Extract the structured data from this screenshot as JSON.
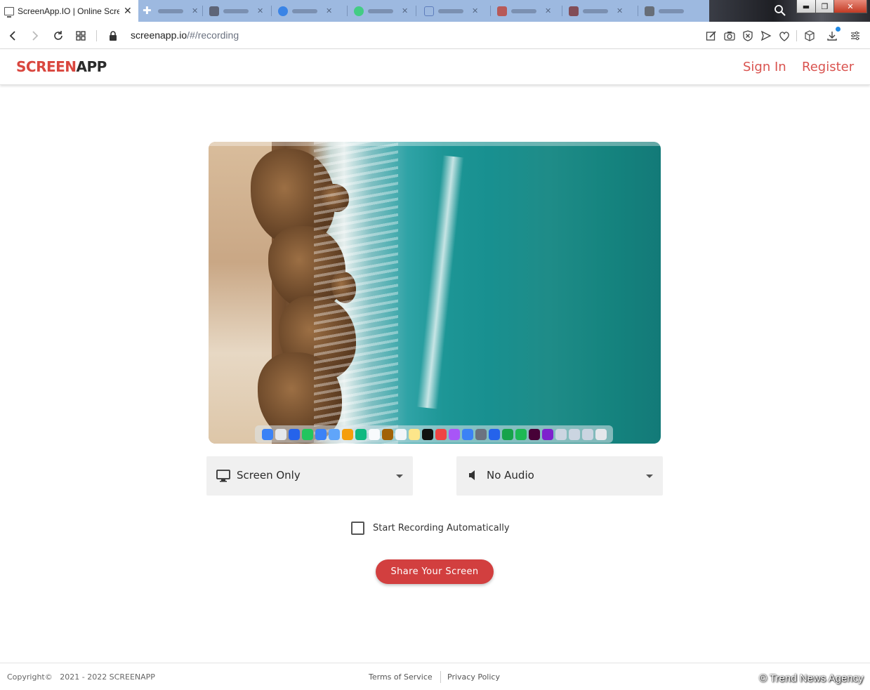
{
  "browser": {
    "active_tab_title": "ScreenApp.IO | Online Scre",
    "address_host": "screenapp.io",
    "address_path": "/#/recording"
  },
  "header": {
    "logo_part1": "SCREEN",
    "logo_part2": "APP",
    "sign_in": "Sign In",
    "register": "Register"
  },
  "controls": {
    "video_source": "Screen Only",
    "audio_source": "No Audio",
    "auto_record_label": "Start Recording Automatically",
    "auto_record_checked": false,
    "share_button": "Share Your Screen"
  },
  "footer": {
    "copyright": "Copyright©   2021 - 2022 SCREENAPP",
    "terms": "Terms of Service",
    "privacy": "Privacy Policy"
  },
  "watermark": "© Trend News Agency",
  "colors": {
    "brand": "#d9473f",
    "button": "#d23f3f"
  }
}
